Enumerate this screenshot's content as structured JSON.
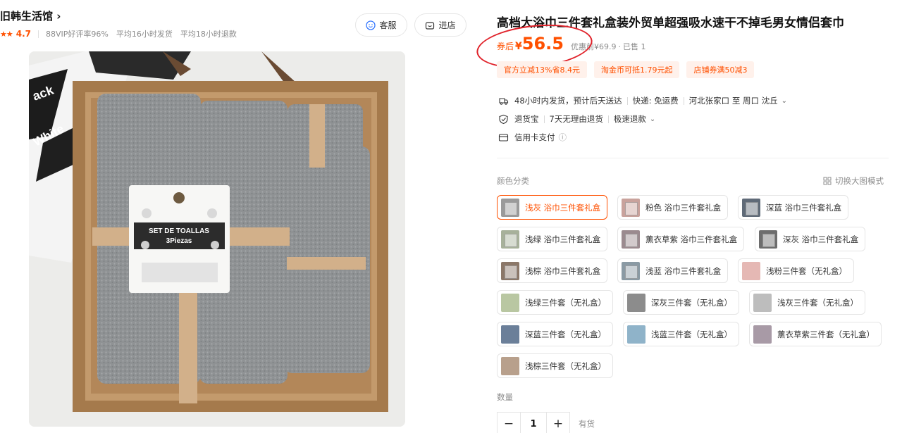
{
  "shop": {
    "name": "旧韩生活馆 ›",
    "stars": "★★",
    "rating": "4.7",
    "meta": [
      "88VIP好评率96%",
      "平均16小时发货",
      "平均18小时退款"
    ],
    "service_label": "客服",
    "store_label": "进店"
  },
  "product": {
    "title": "高档大浴巾三件套礼盒装外贸单超强吸水速干不掉毛男女情侣套巾",
    "image_text": {
      "label_title": "SET DE TOALLAS",
      "label_sub": "3Piezas",
      "bag_line1": "ack",
      "bag_line2": "White"
    }
  },
  "price": {
    "prefix": "券后",
    "symbol": "¥",
    "value": "56.5",
    "original": "优惠前¥69.9",
    "sold": "已售 1"
  },
  "promos": [
    "官方立减13%省8.4元",
    "淘金币可抵1.79元起",
    "店铺券满50减3"
  ],
  "shipping": {
    "time": "48小时内发货，预计后天送达",
    "courier": "快递: 免运费",
    "route": "河北张家口 至 周口 沈丘"
  },
  "returns": {
    "label": "退货宝",
    "policy": "7天无理由退货",
    "speed": "极速退款"
  },
  "payment": {
    "label": "信用卡支付",
    "info_icon": "ⓘ"
  },
  "variants": {
    "label": "颜色分类",
    "toggle": "切换大图模式",
    "items": [
      {
        "label": "浅灰 浴巾三件套礼盒",
        "color": "#9a9a9a",
        "box": true,
        "selected": true
      },
      {
        "label": "粉色 浴巾三件套礼盒",
        "color": "#c9a29c",
        "box": true,
        "selected": false
      },
      {
        "label": "深蓝 浴巾三件套礼盒",
        "color": "#5f6a78",
        "box": true,
        "selected": false
      },
      {
        "label": "浅绿 浴巾三件套礼盒",
        "color": "#a7b19a",
        "box": true,
        "selected": false
      },
      {
        "label": "薰衣草紫 浴巾三件套礼盒",
        "color": "#9b8a8f",
        "box": true,
        "selected": false
      },
      {
        "label": "深灰 浴巾三件套礼盒",
        "color": "#6d6d6d",
        "box": true,
        "selected": false
      },
      {
        "label": "浅棕 浴巾三件套礼盒",
        "color": "#8b7768",
        "box": true,
        "selected": false
      },
      {
        "label": "浅蓝 浴巾三件套礼盒",
        "color": "#8a9aa4",
        "box": true,
        "selected": false
      },
      {
        "label": "浅粉三件套（无礼盒）",
        "color": "#e5b8b4",
        "box": false,
        "selected": false
      },
      {
        "label": "浅绿三件套（无礼盒）",
        "color": "#b9c7a2",
        "box": false,
        "selected": false
      },
      {
        "label": "深灰三件套（无礼盒）",
        "color": "#8c8c8c",
        "box": false,
        "selected": false
      },
      {
        "label": "浅灰三件套（无礼盒）",
        "color": "#bdbdbd",
        "box": false,
        "selected": false
      },
      {
        "label": "深蓝三件套（无礼盒）",
        "color": "#6b7f99",
        "box": false,
        "selected": false
      },
      {
        "label": "浅蓝三件套（无礼盒）",
        "color": "#8fb3c9",
        "box": false,
        "selected": false
      },
      {
        "label": "薰衣草紫三件套（无礼盒）",
        "color": "#a89aa6",
        "box": false,
        "selected": false
      },
      {
        "label": "浅棕三件套（无礼盒）",
        "color": "#b8a08c",
        "box": false,
        "selected": false
      }
    ]
  },
  "quantity": {
    "label": "数量",
    "minus": "−",
    "value": "1",
    "plus": "+",
    "stock": "有货"
  }
}
